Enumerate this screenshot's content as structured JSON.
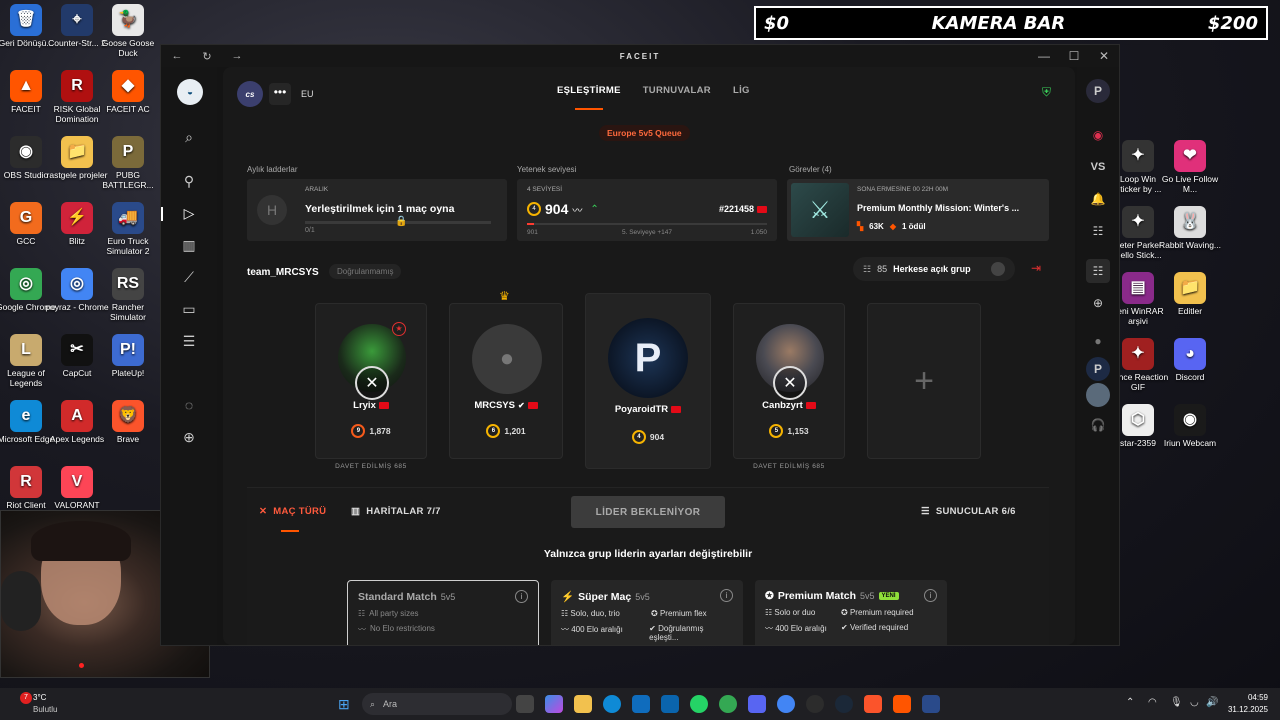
{
  "overlay": {
    "left": "$0",
    "center": "KAMERA BAR",
    "right": "$200"
  },
  "desktop_left": [
    {
      "label": "Geri Dönüşü...",
      "icon": "recycle-bin-icon",
      "glyph": "🗑",
      "color": "#2a6fd6"
    },
    {
      "label": "Counter-Str... 2",
      "icon": "cs2-icon",
      "glyph": "⌖",
      "color": "#223a6a"
    },
    {
      "label": "Goose Goose Duck",
      "icon": "goose-icon",
      "glyph": "🦆",
      "color": "#e8e8e8"
    },
    {
      "label": "FACEIT",
      "icon": "faceit-icon",
      "glyph": "▲",
      "color": "#ff5500"
    },
    {
      "label": "RISK Global Domination",
      "icon": "risk-icon",
      "glyph": "R",
      "color": "#b01010"
    },
    {
      "label": "FACEIT AC",
      "icon": "faceit-ac-icon",
      "glyph": "◆",
      "color": "#ff5500"
    },
    {
      "label": "OBS Studio",
      "icon": "obs-icon",
      "glyph": "◉",
      "color": "#2c2c2c"
    },
    {
      "label": "rastgele projeler",
      "icon": "folder-icon",
      "glyph": "📁",
      "color": "#f2c14e"
    },
    {
      "label": "PUBG BATTLEGR...",
      "icon": "pubg-icon",
      "glyph": "P",
      "color": "#7b6a3a"
    },
    {
      "label": "GCC",
      "icon": "gcc-icon",
      "glyph": "G",
      "color": "#f26b1d"
    },
    {
      "label": "Blitz",
      "icon": "blitz-icon",
      "glyph": "⚡",
      "color": "#d0233a"
    },
    {
      "label": "Euro Truck Simulator 2",
      "icon": "ets2-icon",
      "glyph": "🚚",
      "color": "#2a4a8a"
    },
    {
      "label": "Google Chrome",
      "icon": "chrome-icon",
      "glyph": "◎",
      "color": "#34a853"
    },
    {
      "label": "poyraz - Chrome",
      "icon": "chrome-profile-icon",
      "glyph": "◎",
      "color": "#4285f4"
    },
    {
      "label": "Rancher Simulator",
      "icon": "rancher-icon",
      "glyph": "RS",
      "color": "#444"
    },
    {
      "label": "League of Legends",
      "icon": "lol-icon",
      "glyph": "L",
      "color": "#c8aa6e"
    },
    {
      "label": "CapCut",
      "icon": "capcut-icon",
      "glyph": "✂",
      "color": "#111"
    },
    {
      "label": "PlateUp!",
      "icon": "plateup-icon",
      "glyph": "P!",
      "color": "#3d6bd1"
    },
    {
      "label": "Microsoft Edge",
      "icon": "edge-icon",
      "glyph": "e",
      "color": "#0f8ad6"
    },
    {
      "label": "Apex Legends",
      "icon": "apex-icon",
      "glyph": "A",
      "color": "#d12a2a"
    },
    {
      "label": "Brave",
      "icon": "brave-icon",
      "glyph": "🦁",
      "color": "#fb542b"
    },
    {
      "label": "Riot Client",
      "icon": "riot-icon",
      "glyph": "R",
      "color": "#d13639"
    },
    {
      "label": "VALORANT",
      "icon": "valorant-icon",
      "glyph": "V",
      "color": "#fd4556"
    }
  ],
  "desktop_right": [
    {
      "label": "Loop Win Sticker by ...",
      "icon": "sticker-icon",
      "glyph": "✦",
      "color": "#333"
    },
    {
      "label": "Go Live Follow M...",
      "icon": "follow-icon",
      "glyph": "❤",
      "color": "#e0307a"
    },
    {
      "label": "Peter Parker Hello Stick...",
      "icon": "sticker-icon",
      "glyph": "✦",
      "color": "#333"
    },
    {
      "label": "Rabbit Waving...",
      "icon": "rabbit-icon",
      "glyph": "🐰",
      "color": "#ddd"
    },
    {
      "label": "Yeni WinRAR arşivi",
      "icon": "winrar-icon",
      "glyph": "▤",
      "color": "#8a2a8a"
    },
    {
      "label": "Editler",
      "icon": "folder-icon",
      "glyph": "📁",
      "color": "#f2c14e"
    },
    {
      "label": "Dance Reaction GIF",
      "icon": "gif-icon",
      "glyph": "✦",
      "color": "#a02020"
    },
    {
      "label": "Discord",
      "icon": "discord-icon",
      "glyph": "◕",
      "color": "#5865f2"
    },
    {
      "label": "star-2359",
      "icon": "cube-icon",
      "glyph": "⬡",
      "color": "#eee"
    },
    {
      "label": "Iriun Webcam",
      "icon": "webcam-icon",
      "glyph": "◉",
      "color": "#1a1a1a"
    }
  ],
  "window": {
    "brand": "FACEIT",
    "back": "←",
    "refresh": "↻",
    "forward": "→",
    "minimize": "—",
    "maximize": "☐",
    "close": "✕"
  },
  "topnav": {
    "game": "cs",
    "dots": "•••",
    "region": "EU",
    "tabs": [
      "EŞLEŞTİRME",
      "TURNUVALAR",
      "LİG"
    ],
    "active_tab": "EŞLEŞTİRME"
  },
  "queue": "Europe 5v5 Queue",
  "ladders": {
    "title": "Aylık ladderlar",
    "card_label": "ARALIK",
    "text": "Yerleştirilmek için 1 maç oyna",
    "progress": "0/1"
  },
  "skill": {
    "title": "Yetenek seviyesi",
    "level_label": "4 SEVİYESİ",
    "level": "4",
    "elo": "904",
    "rank": "#221458",
    "min": "901",
    "next": "5. Seviyeye +147",
    "max": "1.050"
  },
  "missions": {
    "title": "Görevler (4)",
    "ends": "SONA ERMESİNE 00 22H 00M",
    "name": "Premium Monthly Mission: Winter's ...",
    "points": "63K",
    "reward": "1 ödül"
  },
  "team": {
    "name": "team_MRCSYS",
    "verify": "Doğrulanmamış",
    "count": "85",
    "party_label": "Herkese açık grup"
  },
  "players": [
    {
      "name": "Lryix",
      "level": "9",
      "elo": "1,878",
      "invited": "DAVET EDİLMİŞ 685"
    },
    {
      "name": "MRCSYS",
      "level": "6",
      "elo": "1,201"
    },
    {
      "name": "PoyaroidTR",
      "level": "4",
      "elo": "904"
    },
    {
      "name": "Canbzyrt",
      "level": "5",
      "elo": "1,153",
      "invited": "DAVET EDİLMİŞ 685"
    }
  ],
  "bottom": {
    "match_type": "MAÇ TÜRÜ",
    "maps": "HARİTALAR 7/7",
    "leader": "LİDER BEKLENİYOR",
    "servers": "SUNUCULAR 6/6",
    "notice": "Yalnızca grup liderin ayarları değiştirebilir"
  },
  "modes": [
    {
      "title": "Standard Match",
      "sub": "5v5",
      "f1": "All party sizes",
      "f2": "No Elo restrictions",
      "f3": "",
      "f4": ""
    },
    {
      "title": "Süper Maç",
      "sub": "5v5",
      "f1": "Solo, duo, trio",
      "f2": "Premium flex",
      "f3": "400 Elo aralığı",
      "f4": "Doğrulanmış eşleşti..."
    },
    {
      "title": "Premium Match",
      "sub": "5v5",
      "badge": "YENİ",
      "f1": "Solo or duo",
      "f2": "Premium required",
      "f3": "400 Elo aralığı",
      "f4": "Verified required"
    }
  ],
  "taskbar": {
    "temp": "3°C",
    "weather": "Bulutlu",
    "search": "Ara",
    "time": "04:59",
    "date": "31.12.2025",
    "notif": "7"
  }
}
